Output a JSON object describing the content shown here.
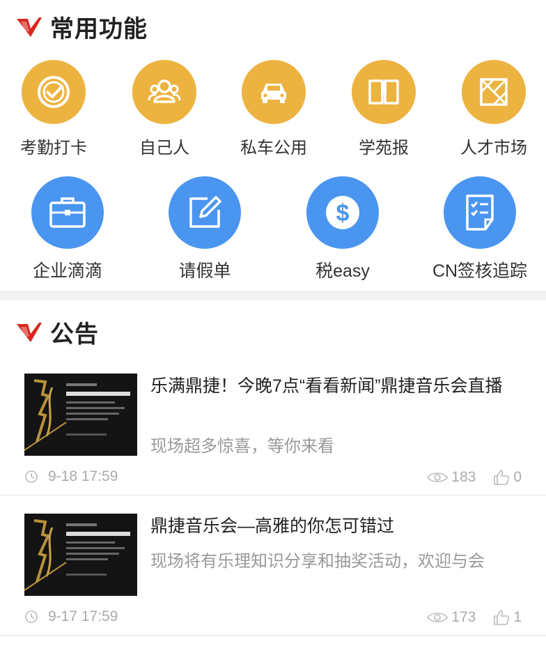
{
  "functions": {
    "title": "常用功能",
    "row1": [
      {
        "label": "考勤打卡",
        "icon": "check-icon"
      },
      {
        "label": "自己人",
        "icon": "people-icon"
      },
      {
        "label": "私车公用",
        "icon": "car-icon"
      },
      {
        "label": "学苑报",
        "icon": "book-icon"
      },
      {
        "label": "人才市场",
        "icon": "market-icon"
      }
    ],
    "row2": [
      {
        "label": "企业滴滴",
        "icon": "briefcase-icon"
      },
      {
        "label": "请假单",
        "icon": "edit-icon"
      },
      {
        "label": "税easy",
        "icon": "dollar-icon"
      },
      {
        "label": "CN签核追踪",
        "icon": "checklist-icon"
      }
    ]
  },
  "announcements": {
    "title": "公告",
    "items": [
      {
        "title": "乐满鼎捷！今晚7点“看看新闻”鼎捷音乐会直播",
        "summary": "现场超多惊喜，等你来看",
        "time": "9-18 17:59",
        "views": "183",
        "likes": "0"
      },
      {
        "title": "鼎捷音乐会—高雅的你怎可错过",
        "summary": "现场将有乐理知识分享和抽奖活动，欢迎与会",
        "time": "9-17 17:59",
        "views": "173",
        "likes": "1"
      }
    ]
  },
  "colors": {
    "yellow": "#EDB340",
    "blue": "#4A95F0",
    "brand_red": "#D9261C"
  }
}
